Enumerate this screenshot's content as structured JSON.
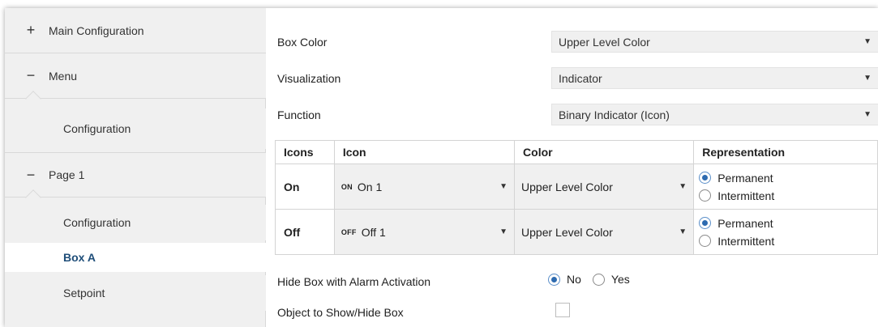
{
  "sidebar": {
    "items": [
      {
        "sign": "+",
        "label": "Main Configuration"
      },
      {
        "sign": "−",
        "label": "Menu"
      },
      {
        "label": "Configuration"
      },
      {
        "sign": "−",
        "label": "Page 1"
      },
      {
        "label": "Configuration"
      },
      {
        "label": "Box A",
        "selected": true
      },
      {
        "label": "Setpoint"
      }
    ]
  },
  "main": {
    "box_color": {
      "label": "Box Color",
      "value": "Upper Level Color"
    },
    "visualization": {
      "label": "Visualization",
      "value": "Indicator"
    },
    "function": {
      "label": "Function",
      "value": "Binary Indicator (Icon)"
    },
    "table": {
      "headers": [
        "Icons",
        "Icon",
        "Color",
        "Representation"
      ],
      "rows": [
        {
          "name": "On",
          "icon_badge": "ON",
          "icon_value": "On 1",
          "color": "Upper Level Color",
          "rep_options": [
            "Permanent",
            "Intermittent"
          ],
          "rep_selected": "Permanent"
        },
        {
          "name": "Off",
          "icon_badge": "OFF",
          "icon_value": "Off 1",
          "color": "Upper Level Color",
          "rep_options": [
            "Permanent",
            "Intermittent"
          ],
          "rep_selected": "Permanent"
        }
      ]
    },
    "hide_box": {
      "label": "Hide Box with Alarm Activation",
      "options": [
        "No",
        "Yes"
      ],
      "selected": "No"
    },
    "object_show_hide": {
      "label": "Object to Show/Hide Box",
      "checked": false
    }
  },
  "icons": {
    "dropdown": "chevron-down-icon",
    "expand": "plus-icon",
    "collapse": "minus-icon"
  },
  "colors": {
    "selected_text": "#1f4e79",
    "panel_bg": "#f0f0f0",
    "radio_accent": "#2e6bb0"
  }
}
